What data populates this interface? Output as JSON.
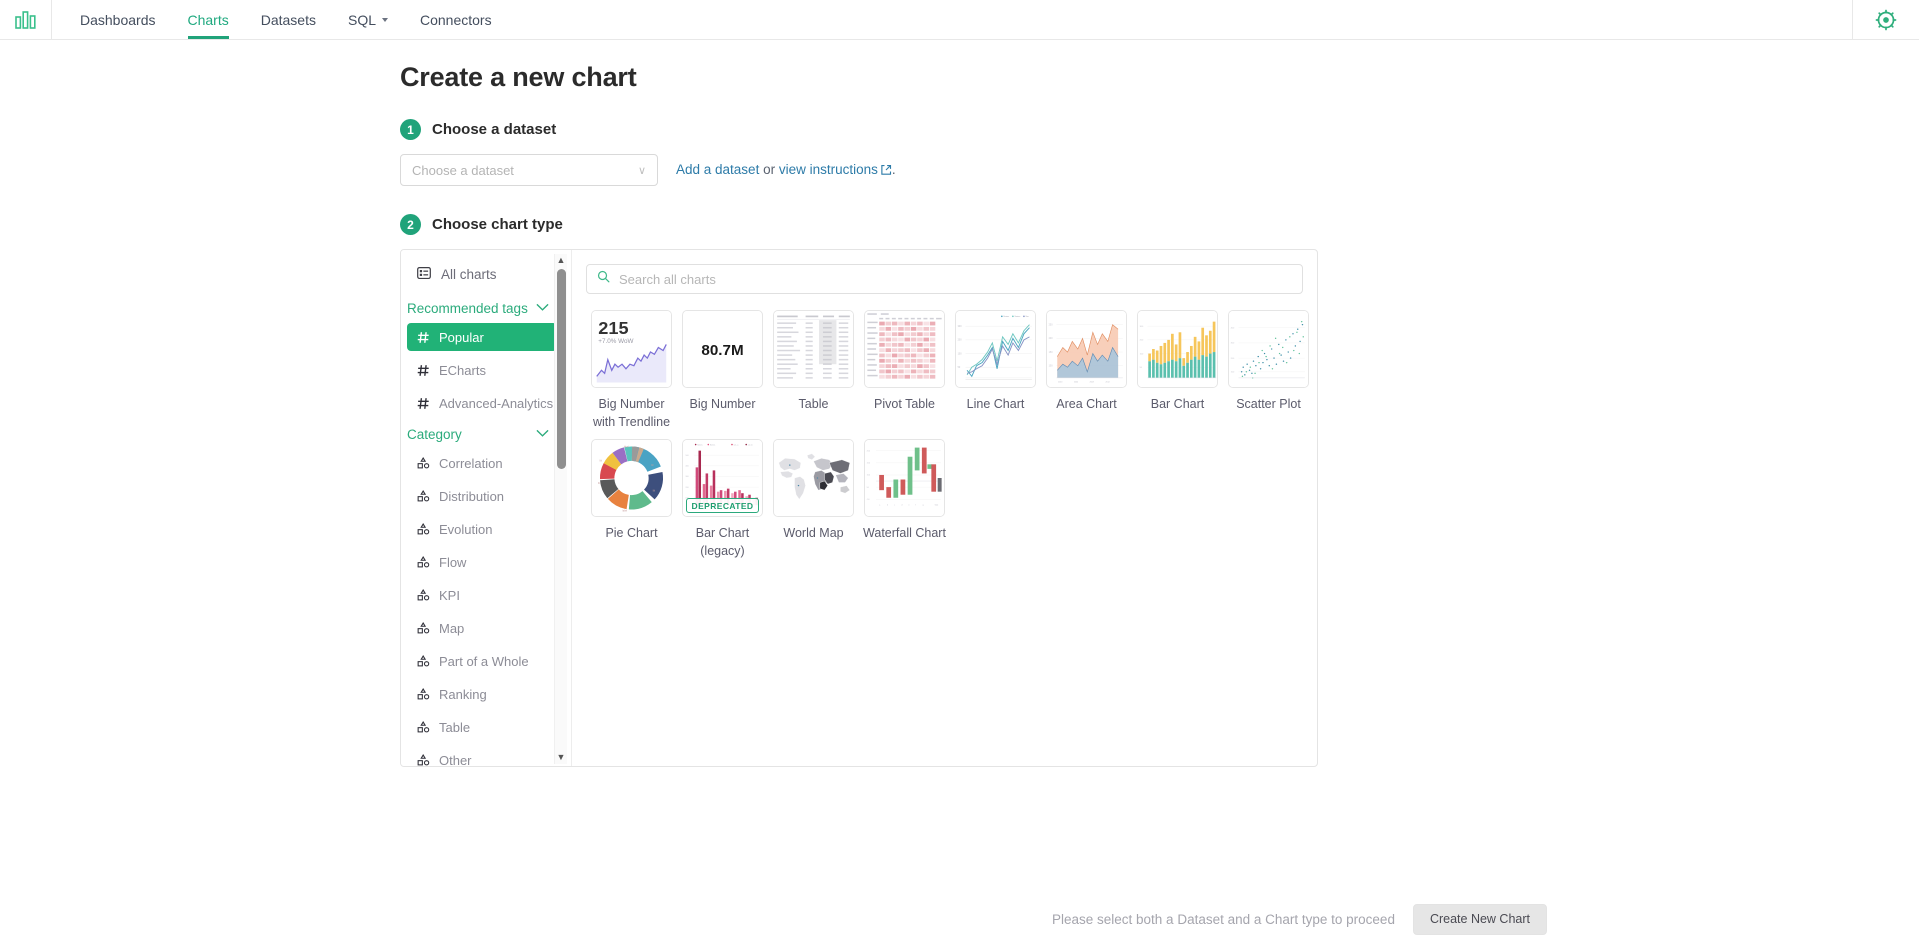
{
  "navbar": {
    "logo_icon": "superset-bars-logo",
    "items": [
      {
        "label": "Dashboards",
        "active": false,
        "has_caret": false
      },
      {
        "label": "Charts",
        "active": true,
        "has_caret": false
      },
      {
        "label": "Datasets",
        "active": false,
        "has_caret": false
      },
      {
        "label": "SQL",
        "active": false,
        "has_caret": true
      },
      {
        "label": "Connectors",
        "active": false,
        "has_caret": false
      }
    ],
    "settings_icon": "gear-icon"
  },
  "page": {
    "title": "Create a new chart"
  },
  "step1": {
    "number": "1",
    "label": "Choose a dataset",
    "select_placeholder": "Choose a dataset",
    "select_value": "",
    "chevron": "∨",
    "link_add": "Add a dataset",
    "link_or": " or ",
    "link_instructions": "view instructions",
    "trailing_period": "."
  },
  "step2": {
    "number": "2",
    "label": "Choose chart type"
  },
  "sidebar": {
    "all_charts": "All charts",
    "groups": [
      {
        "title": "Recommended tags",
        "items": [
          {
            "label": "Popular",
            "selected": true
          },
          {
            "label": "ECharts",
            "selected": false
          },
          {
            "label": "Advanced-Analytics",
            "selected": false
          }
        ]
      },
      {
        "title": "Category",
        "items": [
          {
            "label": "Correlation",
            "selected": false
          },
          {
            "label": "Distribution",
            "selected": false
          },
          {
            "label": "Evolution",
            "selected": false
          },
          {
            "label": "Flow",
            "selected": false
          },
          {
            "label": "KPI",
            "selected": false
          },
          {
            "label": "Map",
            "selected": false
          },
          {
            "label": "Part of a Whole",
            "selected": false
          },
          {
            "label": "Ranking",
            "selected": false
          },
          {
            "label": "Table",
            "selected": false
          },
          {
            "label": "Other",
            "selected": false
          }
        ]
      }
    ]
  },
  "search": {
    "placeholder": "Search all charts",
    "value": "",
    "icon": "search-icon"
  },
  "charts": [
    {
      "name": "Big Number with Trendline",
      "thumb": "big-number-trendline",
      "big_value": "215",
      "subtext": "+7.0% WoW",
      "deprecated": false
    },
    {
      "name": "Big Number",
      "thumb": "big-number",
      "big_value": "80.7M",
      "deprecated": false
    },
    {
      "name": "Table",
      "thumb": "table",
      "deprecated": false
    },
    {
      "name": "Pivot Table",
      "thumb": "pivot-table",
      "deprecated": false
    },
    {
      "name": "Line Chart",
      "thumb": "line-chart",
      "deprecated": false
    },
    {
      "name": "Area Chart",
      "thumb": "area-chart",
      "deprecated": false
    },
    {
      "name": "Bar Chart",
      "thumb": "bar-chart",
      "deprecated": false
    },
    {
      "name": "Scatter Plot",
      "thumb": "scatter-plot",
      "deprecated": false
    },
    {
      "name": "Pie Chart",
      "thumb": "pie-chart",
      "deprecated": false
    },
    {
      "name": "Bar Chart (legacy)",
      "thumb": "bar-chart-legacy",
      "deprecated": true,
      "deprecated_label": "DEPRECATED"
    },
    {
      "name": "World Map",
      "thumb": "world-map",
      "deprecated": false
    },
    {
      "name": "Waterfall Chart",
      "thumb": "waterfall-chart",
      "deprecated": false
    }
  ],
  "footer": {
    "note": "Please select both a Dataset and a Chart type to proceed",
    "create_button": "Create New Chart"
  },
  "colors": {
    "brand_green": "#20a37a",
    "selected_green": "#21b277",
    "link_blue": "#2d7ba8",
    "muted_text": "#8c8c96"
  }
}
